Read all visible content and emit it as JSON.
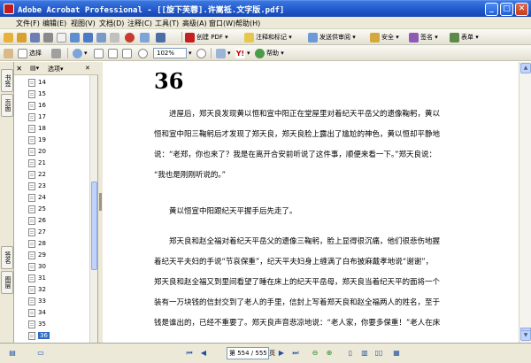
{
  "window": {
    "title": "Adobe Acrobat Professional - [[旋下芙蓉].许嵩祗.文字版.pdf]",
    "minimize": "_",
    "maximize": "□",
    "close": "✕"
  },
  "menu": [
    "文件(F)",
    "编辑(E)",
    "视图(V)",
    "文档(D)",
    "注释(C)",
    "工具(T)",
    "高级(A)",
    "窗口(W)",
    "帮助(H)"
  ],
  "toolbar1": {
    "print_label": "",
    "create_pdf": "创建 PDF",
    "review": "注释和标记",
    "send": "发送供审阅",
    "secure": "安全",
    "sign": "签名",
    "forms": "表单"
  },
  "toolbar2": {
    "select": "选择",
    "zoom": "102%",
    "help": "帮助"
  },
  "left_tabs": [
    "书签",
    "页面",
    "签名",
    "图层"
  ],
  "nav": {
    "options_label": "选项",
    "bookmarks": [
      "14",
      "15",
      "16",
      "17",
      "18",
      "19",
      "20",
      "21",
      "22",
      "23",
      "24",
      "25",
      "26",
      "27",
      "28",
      "29",
      "30",
      "31",
      "32",
      "33",
      "34",
      "35",
      "36"
    ],
    "selected": "36"
  },
  "document": {
    "page_heading": "36",
    "paragraphs": [
      [
        "进屋后，郑天良发现黄以恒和宣中阳正在堂屋里对着纪天平岳父的遗像鞠躬，黄以",
        "恒和宣中阳三鞠躬后才发现了郑天良，郑天良脸上露出了尴尬的神色，黄以恒却平静地",
        "说：“老郑，你也来了？我是在离开合安前听说了这件事，顺便来看一下。”郑天良说：",
        "“我也是刚刚听说的。”"
      ],
      [
        "黄以恒宣中阳跟纪天平握手后先走了。"
      ],
      [
        "郑天良和赵全福对着纪天平岳父的遗像三鞠躬，脸上显得很沉痛，他们很悲伤地握",
        "着纪天平夫妇的手说“节哀保重”，纪天平夫妇身上缠满了白布披麻戴孝地说“谢谢”，",
        "郑天良和赵全福又到里间看望了睡在床上的纪天平岳母，郑天良当着纪天平的面将一个",
        "装有一万块钱的信封交到了老人的手里，信封上写着郑天良和赵全福两人的姓名，至于",
        "钱是谁出的，已经不重要了。郑天良声音悲凉地说：“老人家，你要多保重！”老人在床"
      ]
    ]
  },
  "status": {
    "page_box": "第 554 / 555 页"
  }
}
